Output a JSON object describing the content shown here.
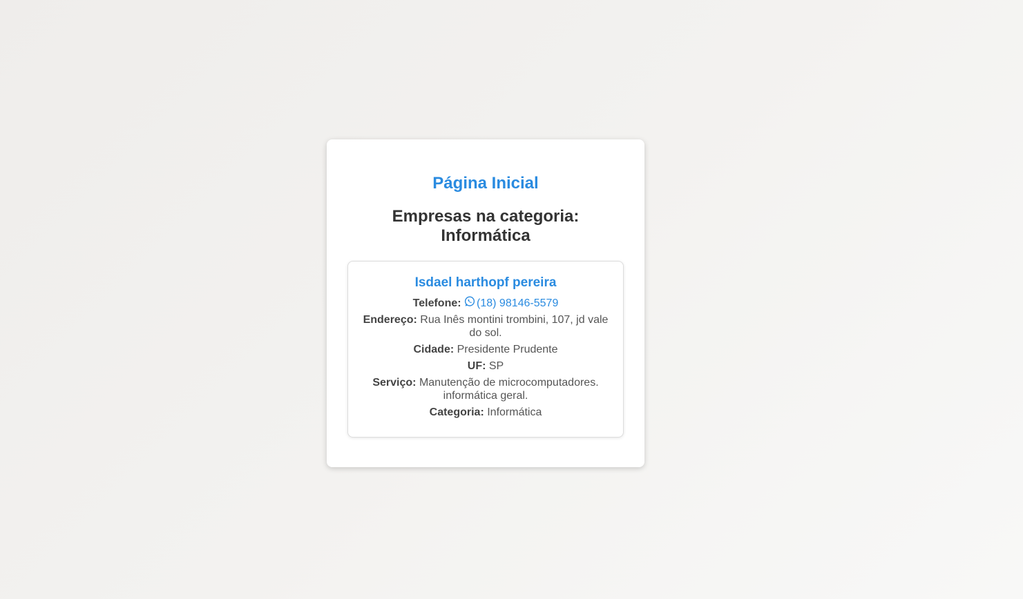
{
  "header": {
    "home_link": "Página Inicial",
    "category_title": "Empresas na categoria: Informática"
  },
  "colors": {
    "accent": "#2a8be0",
    "text": "#333333",
    "background": "#f3f2f0"
  },
  "company": {
    "name": "Isdael harthopf pereira",
    "phone_label": "Telefone:",
    "phone_icon": "whatsapp-icon",
    "phone_value": "(18) 98146-5579",
    "address_label": "Endereço:",
    "address_value": "Rua Inês montini trombini, 107, jd vale do sol.",
    "city_label": "Cidade:",
    "city_value": "Presidente Prudente",
    "uf_label": "UF:",
    "uf_value": "SP",
    "service_label": "Serviço:",
    "service_value": "Manutenção de microcomputadores. informática geral.",
    "category_label": "Categoria:",
    "category_value": "Informática"
  }
}
